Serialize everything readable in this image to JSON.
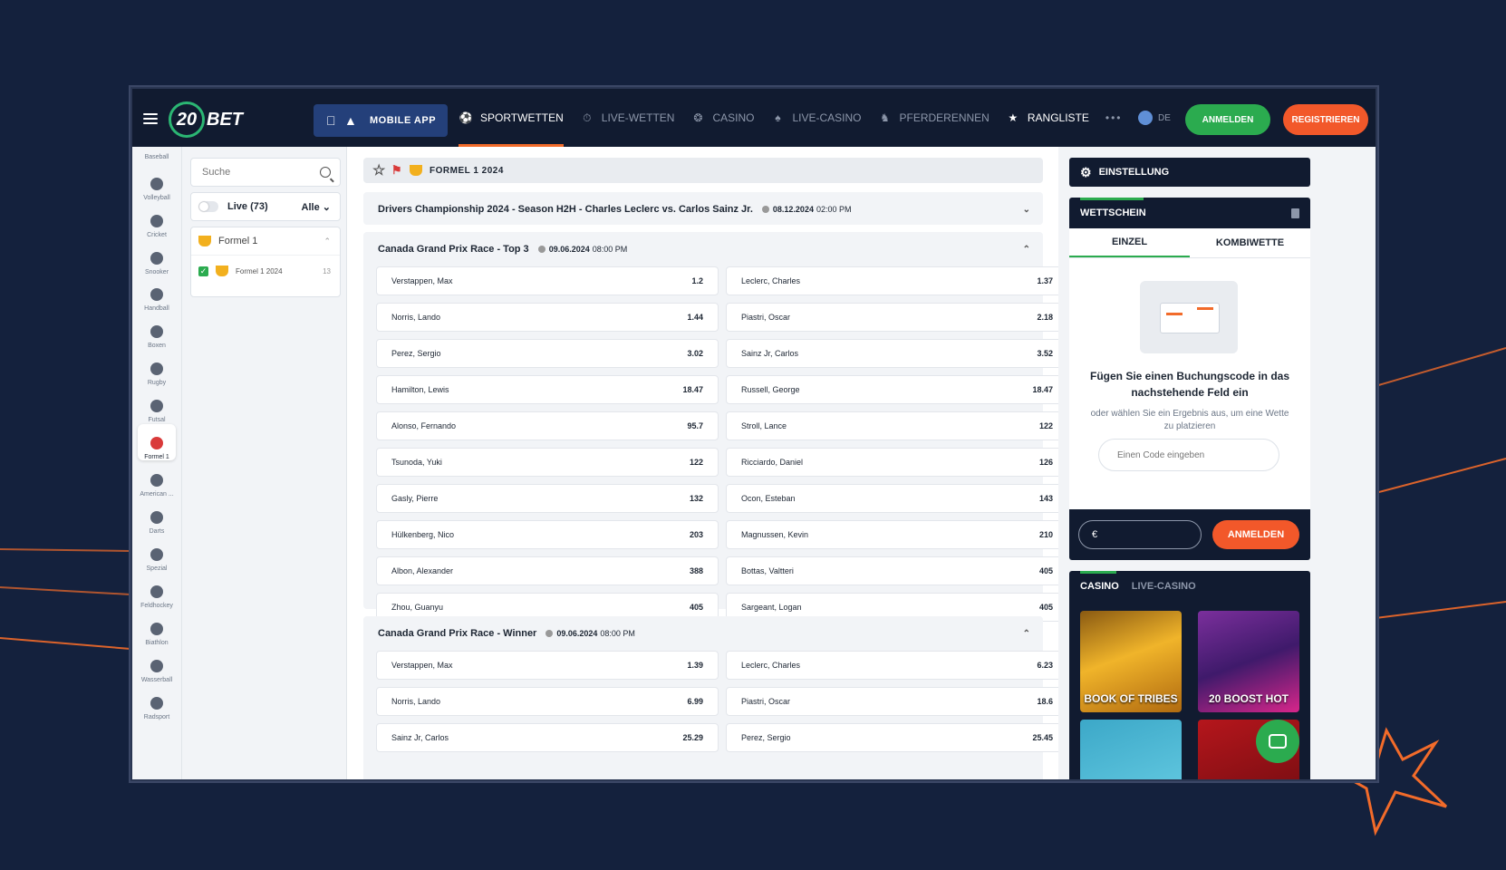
{
  "header": {
    "logo_number": "20",
    "logo_text": "BET",
    "mobile_app_label": "MOBILE APP",
    "nav": [
      {
        "label": "SPORTWETTEN",
        "icon": "soccer-ball-icon"
      },
      {
        "label": "LIVE-WETTEN",
        "icon": "stopwatch-icon"
      },
      {
        "label": "CASINO",
        "icon": "casino-chip-icon"
      },
      {
        "label": "LIVE-CASINO",
        "icon": "cards-icon"
      },
      {
        "label": "PFERDERENNEN",
        "icon": "horse-icon"
      },
      {
        "label": "RANGLISTE",
        "icon": "laurel-icon"
      }
    ],
    "more_label": "•••",
    "language": "DE",
    "login_label": "ANMELDEN",
    "register_label": "REGISTRIEREN"
  },
  "rail": {
    "top_label": "Baseball",
    "items": [
      "Volleyball",
      "Cricket",
      "Snooker",
      "Handball",
      "Boxen",
      "Rugby",
      "Futsal",
      "Formel 1",
      "American ...",
      "Darts",
      "Spezial",
      "Feldhockey",
      "Biathlon",
      "Wasserball",
      "Radsport"
    ]
  },
  "filter": {
    "search_placeholder": "Suche",
    "live_label": "Live (73)",
    "alle_label": "Alle",
    "category": "Formel 1",
    "sub_label": "Formel 1 2024",
    "sub_count": "13"
  },
  "main": {
    "breadcrumb": "FORMEL 1 2024",
    "collapsed_event": {
      "title": "Drivers Championship 2024 - Season H2H - Charles Leclerc vs. Carlos Sainz Jr.",
      "date": "08.12.2024",
      "time": "02:00 PM"
    },
    "top3": {
      "title": "Canada Grand Prix Race - Top 3",
      "date": "09.06.2024",
      "time": "08:00 PM",
      "odds": [
        [
          "Verstappen, Max",
          "1.2"
        ],
        [
          "Leclerc, Charles",
          "1.37"
        ],
        [
          "Norris, Lando",
          "1.44"
        ],
        [
          "Piastri, Oscar",
          "2.18"
        ],
        [
          "Perez, Sergio",
          "3.02"
        ],
        [
          "Sainz Jr, Carlos",
          "3.52"
        ],
        [
          "Hamilton, Lewis",
          "18.47"
        ],
        [
          "Russell, George",
          "18.47"
        ],
        [
          "Alonso, Fernando",
          "95.7"
        ],
        [
          "Stroll, Lance",
          "122"
        ],
        [
          "Tsunoda, Yuki",
          "122"
        ],
        [
          "Ricciardo, Daniel",
          "126"
        ],
        [
          "Gasly, Pierre",
          "132"
        ],
        [
          "Ocon, Esteban",
          "143"
        ],
        [
          "Hülkenberg, Nico",
          "203"
        ],
        [
          "Magnussen, Kevin",
          "210"
        ],
        [
          "Albon, Alexander",
          "388"
        ],
        [
          "Bottas, Valtteri",
          "405"
        ],
        [
          "Zhou, Guanyu",
          "405"
        ],
        [
          "Sargeant, Logan",
          "405"
        ]
      ]
    },
    "winner": {
      "title": "Canada Grand Prix Race - Winner",
      "date": "09.06.2024",
      "time": "08:00 PM",
      "odds": [
        [
          "Verstappen, Max",
          "1.39"
        ],
        [
          "Leclerc, Charles",
          "6.23"
        ],
        [
          "Norris, Lando",
          "6.99"
        ],
        [
          "Piastri, Oscar",
          "18.6"
        ],
        [
          "Sainz Jr, Carlos",
          "25.29"
        ],
        [
          "Perez, Sergio",
          "25.45"
        ]
      ]
    }
  },
  "right": {
    "settings_label": "EINSTELLUNG",
    "slip_title": "WETTSCHEIN",
    "tab_single": "EINZEL",
    "tab_combo": "KOMBIWETTE",
    "empty_title": "Fügen Sie einen Buchungscode in das nachstehende Feld ein",
    "empty_sub": "oder wählen Sie ein Ergebnis aus, um eine Wette zu platzieren",
    "code_placeholder": "Einen Code eingeben",
    "currency": "€",
    "submit_label": "ANMELDEN",
    "casino_tab": "CASINO",
    "live_casino_tab": "LIVE-CASINO",
    "games": [
      "BOOK OF TRIBES",
      "20 BOOST HOT"
    ]
  },
  "colors": {
    "background": "#14213d",
    "accent_green": "#2bab4f",
    "accent_orange": "#f2582a",
    "header": "#111b30"
  }
}
